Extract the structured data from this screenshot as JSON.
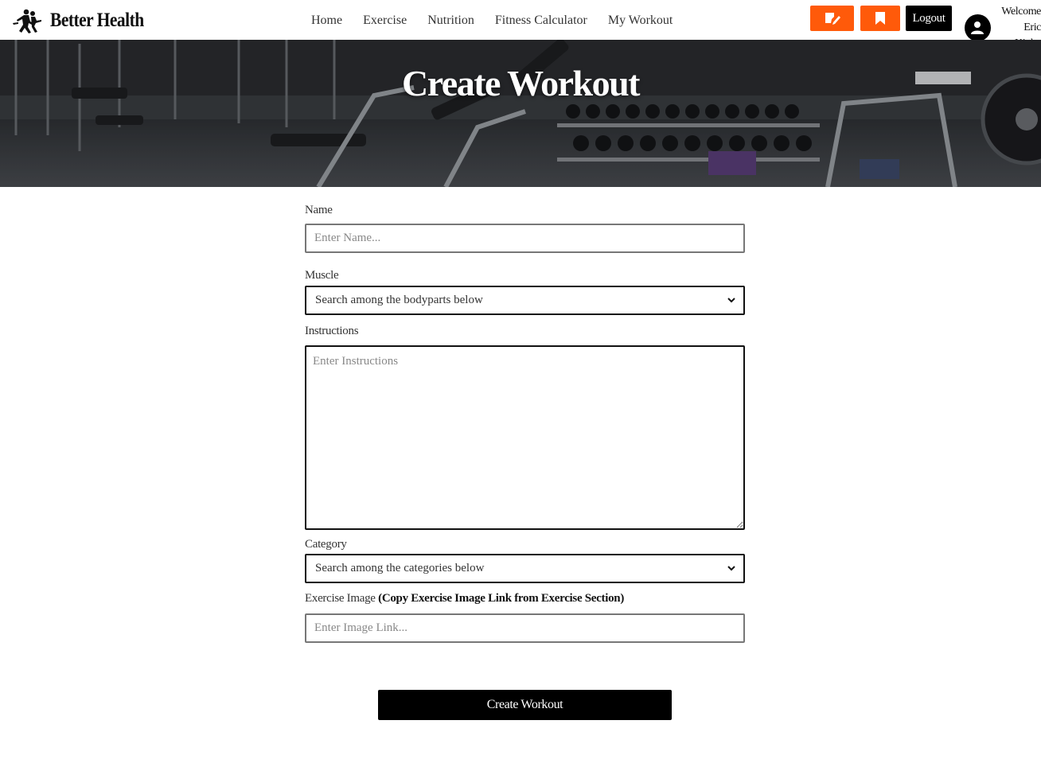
{
  "brand": {
    "name": "Better Health",
    "icon": "running-people-logo"
  },
  "nav": {
    "links": [
      "Home",
      "Exercise",
      "Nutrition",
      "Fitness Calculator",
      "My Workout"
    ],
    "create_icon": "edit-note-icon",
    "saved_icon": "bookmark-icon",
    "logout_label": "Logout",
    "welcome_text": "Welcome",
    "user_name": "Eric Kioko",
    "accent_color": "#ff5a0a"
  },
  "hero": {
    "title": "Create Workout"
  },
  "form": {
    "name_label": "Name",
    "name_placeholder": "Enter Name...",
    "muscle_label": "Muscle",
    "muscle_selected": "Search among the bodyparts below",
    "instructions_label": "Instructions",
    "instructions_placeholder": "Enter Instructions",
    "category_label": "Category",
    "category_selected": "Search among the categories below",
    "image_label": "Exercise Image",
    "image_hint": "(Copy Exercise Image Link from Exercise Section)",
    "image_placeholder": "Enter Image Link...",
    "submit_label": "Create Workout"
  }
}
